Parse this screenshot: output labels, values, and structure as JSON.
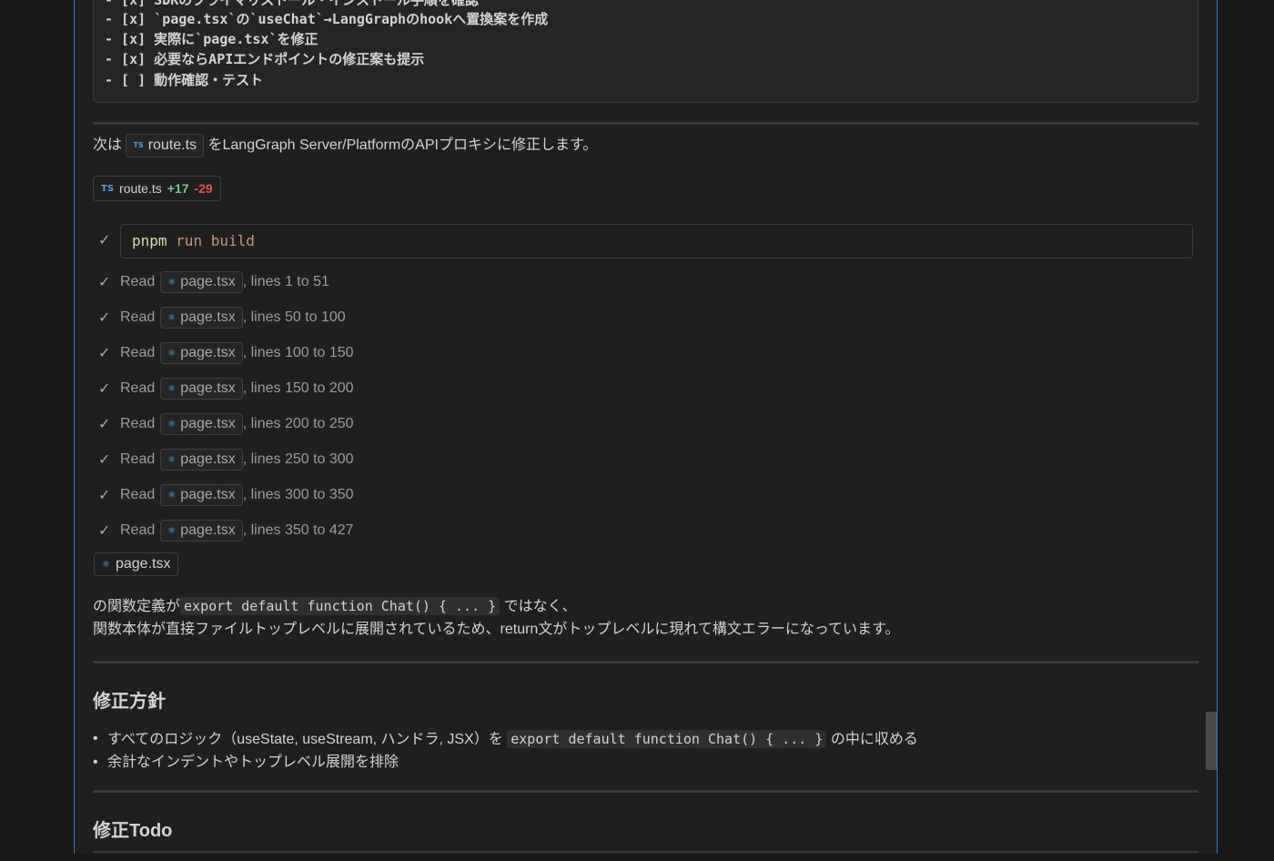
{
  "todo_block": {
    "lines": [
      "- [x] SDKのプライマリストール・インストール手順を確認",
      "- [x] `page.tsx`の`useChat`→LangGraphのhookへ置換案を作成",
      "- [x] 実際に`page.tsx`を修正",
      "- [x] 必要ならAPIエンドポイントの修正案も提示",
      "- [ ] 動作確認・テスト"
    ]
  },
  "intro": {
    "before": "次は",
    "file": "route.ts",
    "after": "をLangGraph Server/PlatformのAPIプロキシに修正します。"
  },
  "edit_badge": {
    "icon": "TS",
    "file": "route.ts",
    "added": "+17",
    "removed": "-29"
  },
  "terminal": {
    "command": "pnpm",
    "args": "run build"
  },
  "reads": [
    {
      "verb": "Read",
      "file": "page.tsx",
      "range": ", lines 1 to 51"
    },
    {
      "verb": "Read",
      "file": "page.tsx",
      "range": ", lines 50 to 100"
    },
    {
      "verb": "Read",
      "file": "page.tsx",
      "range": ", lines 100 to 150"
    },
    {
      "verb": "Read",
      "file": "page.tsx",
      "range": ", lines 150 to 200"
    },
    {
      "verb": "Read",
      "file": "page.tsx",
      "range": ", lines 200 to 250"
    },
    {
      "verb": "Read",
      "file": "page.tsx",
      "range": ", lines 250 to 300"
    },
    {
      "verb": "Read",
      "file": "page.tsx",
      "range": ", lines 300 to 350"
    },
    {
      "verb": "Read",
      "file": "page.tsx",
      "range": ", lines 350 to 427"
    }
  ],
  "file_ref": "page.tsx",
  "explanation": {
    "line1_before": "の関数定義が",
    "line1_code": "export default function Chat() { ... }",
    "line1_after": "ではなく、",
    "line2": "関数本体が直接ファイルトップレベルに展開されているため、return文がトップレベルに現れて構文エラーになっています。"
  },
  "plan": {
    "heading": "修正方針",
    "bullet1_before": "すべてのロジック（useState, useStream, ハンドラ, JSX）を",
    "bullet1_code": "export default function Chat() { ... }",
    "bullet1_after": "の中に収める",
    "bullet2": "余計なインデントやトップレベル展開を排除"
  },
  "todo_heading": "修正Todo",
  "colors": {
    "accent_border": "#2b79d1",
    "added": "#73c991",
    "removed": "#f14c4c"
  }
}
